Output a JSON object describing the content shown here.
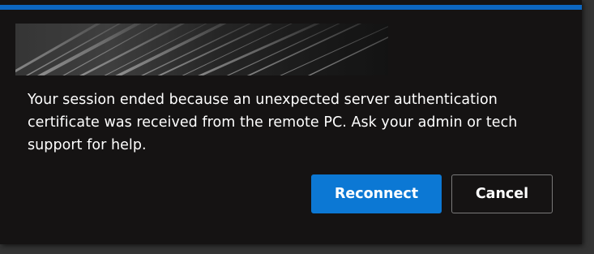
{
  "dialog": {
    "accent_color": "#0c66c0",
    "banner_image": "streaked-gray-abstract-image",
    "message": "Your session ended because an unexpected server authentication certificate was received from the remote PC. Ask your admin or tech support for help.",
    "buttons": {
      "reconnect_label": "Reconnect",
      "cancel_label": "Cancel"
    }
  }
}
